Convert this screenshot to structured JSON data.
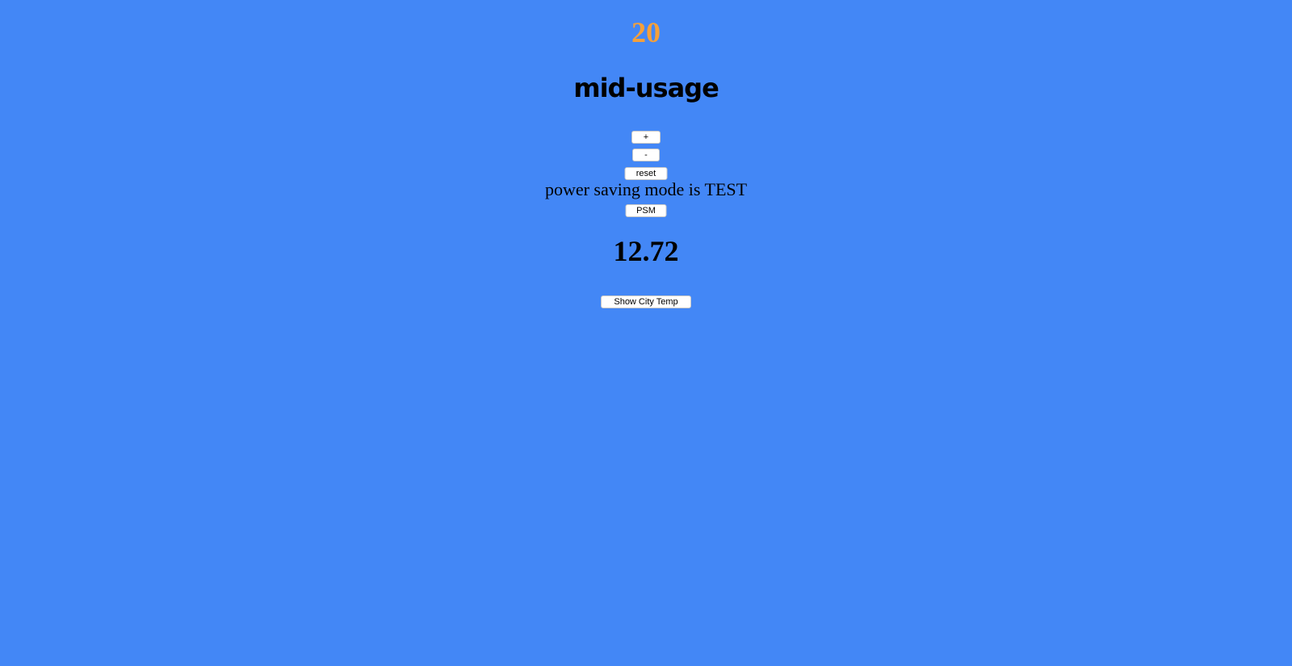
{
  "thermostat": {
    "temperature": "20",
    "usage_level": "mid-usage",
    "colors": {
      "background": "#4387f6",
      "temperature_text": "#f5a03a"
    }
  },
  "controls": {
    "increase_label": "+",
    "decrease_label": "-",
    "reset_label": "reset"
  },
  "power_saving": {
    "status_text": "power saving mode is TEST",
    "toggle_label": "PSM"
  },
  "city": {
    "temperature": "12.72",
    "show_button_label": "Show City Temp"
  }
}
